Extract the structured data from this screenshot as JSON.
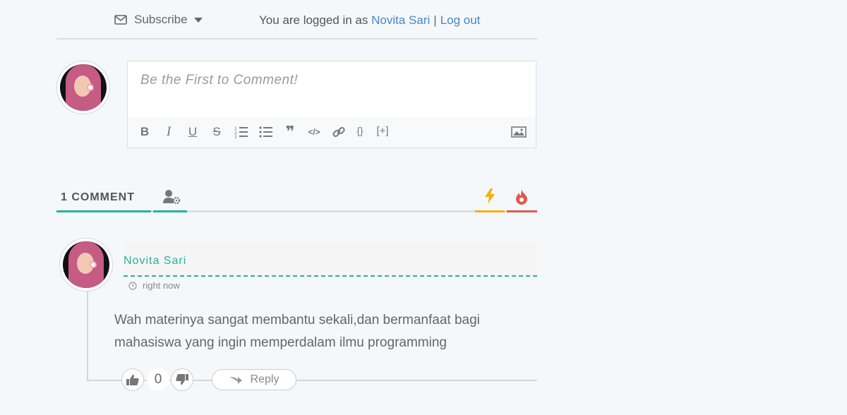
{
  "topbar": {
    "subscribe_label": "Subscribe",
    "login_prefix": "You are logged in as",
    "user_name": "Novita Sari",
    "separator": "|",
    "logout_label": "Log out"
  },
  "editor": {
    "placeholder": "Be the First to Comment!",
    "toolbar": {
      "bold": "B",
      "italic": "I",
      "underline": "U",
      "strikethrough": "S",
      "quote": "❞",
      "code": "</>",
      "source_code": "{}",
      "spoiler": "[+]"
    }
  },
  "comments_header": {
    "count_label": "1 COMMENT",
    "accent_color": "#26b39c",
    "newest_color": "#f3b10a",
    "popular_color": "#e2584d"
  },
  "comment": {
    "author": "Novita Sari",
    "time": "right now",
    "text": "Wah materinya sangat membantu sekali,dan bermanfaat bagi mahasiswa yang ingin memperdalam ilmu programming",
    "vote_count": "0",
    "reply_label": "Reply"
  },
  "icons": [
    "envelope-icon",
    "caret-down-icon",
    "user-settings-icon",
    "bolt-icon",
    "flame-icon",
    "clock-icon",
    "thumbs-up-icon",
    "thumbs-down-icon",
    "reply-arrow-icon",
    "image-icon",
    "link-icon",
    "ordered-list-icon",
    "unordered-list-icon"
  ]
}
